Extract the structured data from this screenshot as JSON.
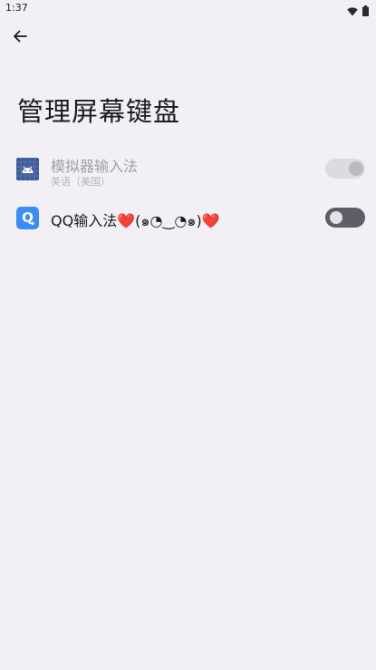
{
  "status_bar": {
    "time": "1:37",
    "icons": [
      "wifi-icon",
      "battery-icon"
    ]
  },
  "header": {
    "back_icon": "arrow-back-icon",
    "title": "管理屏幕键盘"
  },
  "keyboards": [
    {
      "name": "模拟器输入法",
      "subtitle": "英语（美国）",
      "icon": "android-keyboard-icon",
      "enabled": false,
      "toggle_on": true
    },
    {
      "name": "QQ输入法❤️(๑◔‿◔๑)❤️",
      "icon": "qq-input-icon",
      "icon_letter": "Q",
      "enabled": true,
      "toggle_on": false
    }
  ],
  "colors": {
    "background": "#f2f0f5",
    "android_icon_bg": "#3f5c9a",
    "qq_icon_bg": "#3b8cf7"
  }
}
